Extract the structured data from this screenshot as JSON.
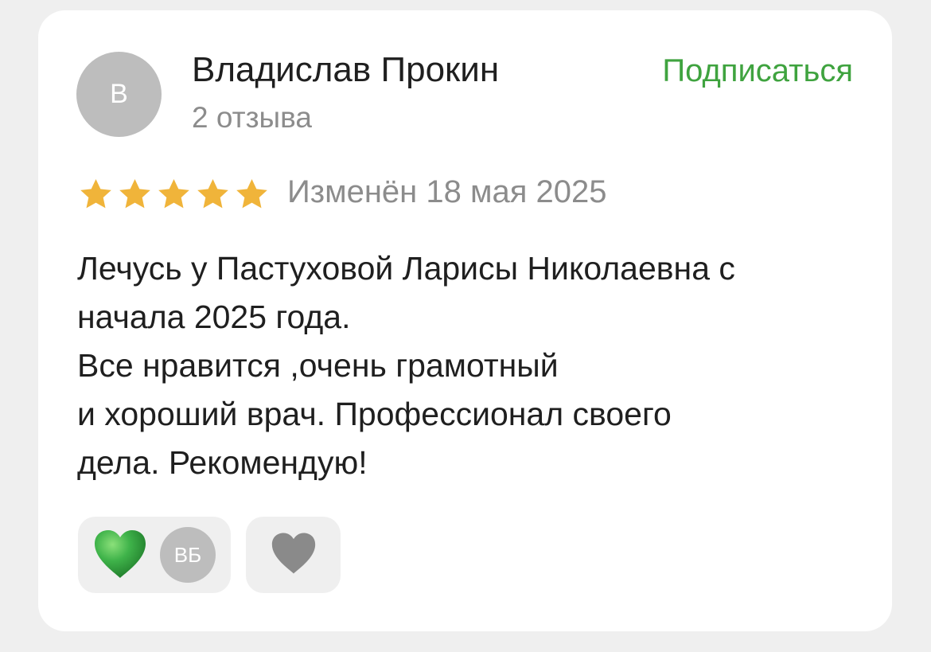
{
  "review": {
    "author": {
      "avatar_letter": "В",
      "name": "Владислав Прокин",
      "review_count": "2 отзыва"
    },
    "subscribe_label": "Подписаться",
    "rating": {
      "value": 5,
      "max": 5,
      "star_color": "#f0b43a"
    },
    "edited_label": "Изменён 18 мая 2025",
    "text_lines": [
      "Лечусь у Пастуховой Ларисы Николаевна с",
      "начала 2025 года.",
      "Все нравится ,очень грамотный",
      "и хороший врач. Профессионал своего",
      "дела. Рекомендую!"
    ],
    "reactions": {
      "liked_icon": "green-heart-icon",
      "liked_by_initials": "ВБ",
      "like_icon": "gray-heart-icon"
    }
  },
  "colors": {
    "accent_green": "#3fa33f",
    "heart_green": "#3fb34a",
    "heart_gray": "#8a8a8a",
    "muted_text": "#8c8c8c",
    "background": "#efefef"
  }
}
